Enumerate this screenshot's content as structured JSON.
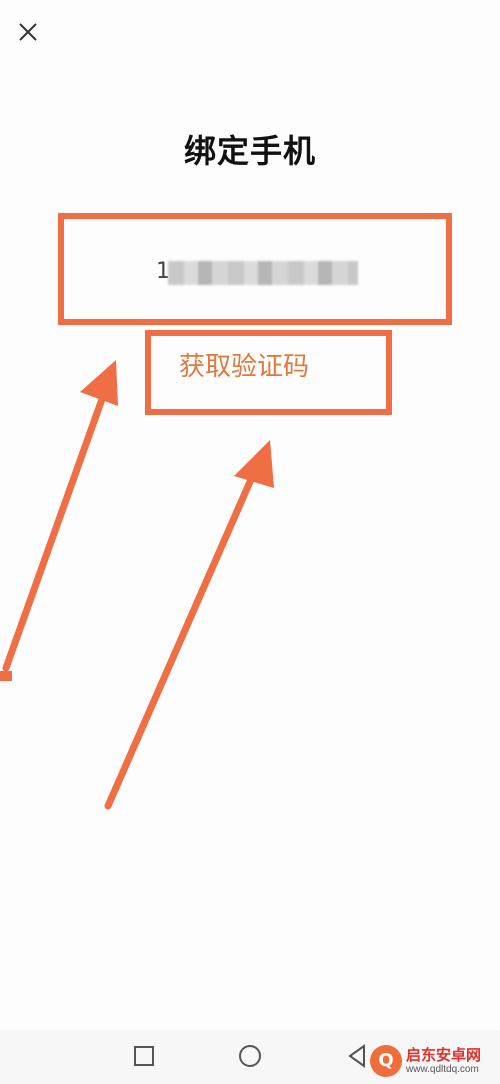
{
  "header": {
    "title": "绑定手机",
    "close_icon": "close-icon"
  },
  "phone": {
    "visible_digit": "1"
  },
  "verify": {
    "label": "获取验证码"
  },
  "annotation": {
    "color": "#f06e43"
  },
  "nav": {
    "icons": [
      "square-icon",
      "circle-icon",
      "triangle-back-icon"
    ]
  },
  "watermark": {
    "title": "启东安卓网",
    "url": "www.qdltdq.com"
  }
}
